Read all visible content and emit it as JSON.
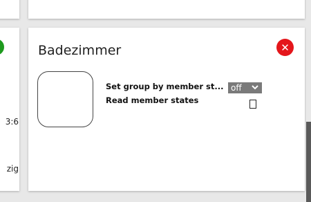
{
  "left_card": {
    "status_icon": "check-circle-icon",
    "fragment_1": "3:6",
    "fragment_2": "zig"
  },
  "group_card": {
    "title": "Badezimmer",
    "close_icon": "close-circle-icon",
    "properties": {
      "set_group_label": "Set group by member st...",
      "set_group_value": "off",
      "read_member_label": "Read member states",
      "read_member_checked": false
    }
  },
  "colors": {
    "close": "#e4161b",
    "check": "#1e9a1e",
    "select_bg": "#7a7a7a"
  }
}
